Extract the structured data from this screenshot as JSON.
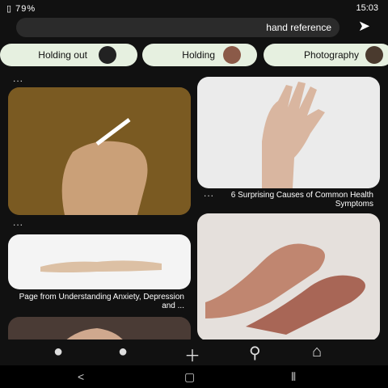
{
  "status": {
    "time": "15:03",
    "battery": "79%"
  },
  "search": {
    "query": "hand reference"
  },
  "chips": [
    {
      "label": "Photography"
    },
    {
      "label": "Holding"
    },
    {
      "label": "Holding out"
    }
  ],
  "pins": [
    {
      "caption": "6 Surprising Causes of Common Health Symptoms"
    },
    {
      "caption": "Page from Understanding Anxiety, Depression and ..."
    }
  ],
  "more_label": "...",
  "colors": {
    "background": "#111111",
    "chip_bg": "#e6f0e0",
    "search_bg": "#2b2b2b"
  },
  "icons": {
    "nav": [
      "home-icon",
      "search-icon",
      "plus-icon",
      "chat-icon",
      "profile-icon"
    ],
    "system": [
      "recents-icon",
      "home-button-icon",
      "back-icon"
    ]
  }
}
